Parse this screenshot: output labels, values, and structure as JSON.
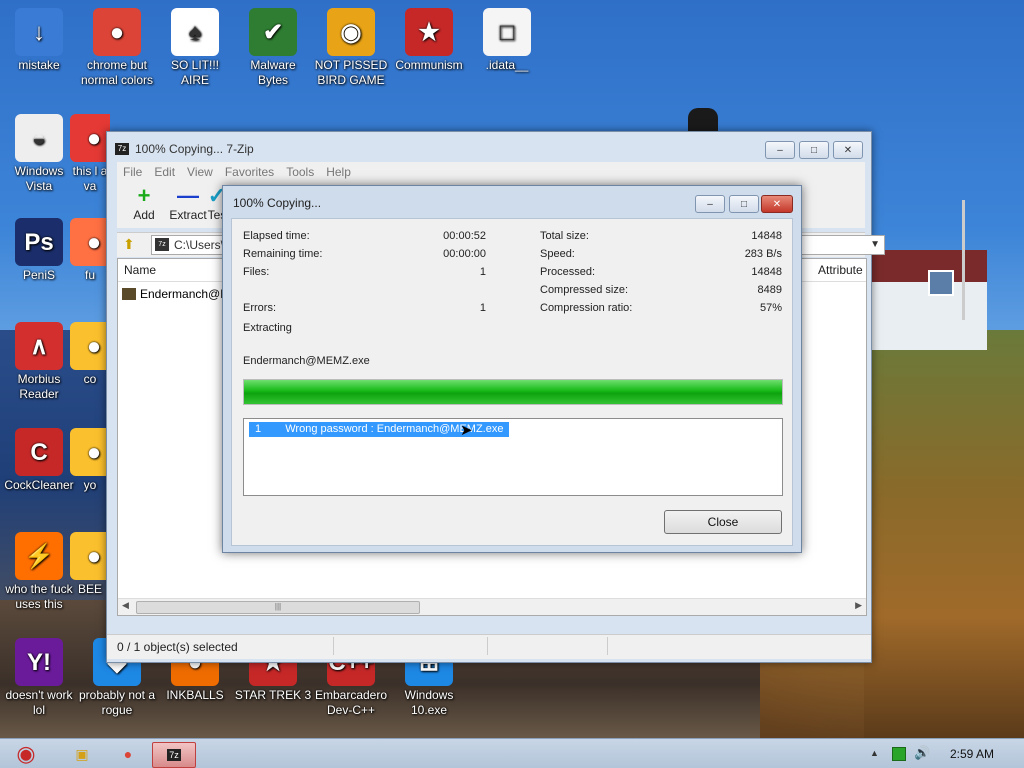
{
  "desktop_icons": [
    {
      "label": "mistake",
      "glyph": "↓",
      "color": "#3a7bd5"
    },
    {
      "label": "chrome but normal colors",
      "glyph": "●",
      "color": "#db4437"
    },
    {
      "label": "SO LIT!!! AIRE",
      "glyph": "♠",
      "color": "#ffffff"
    },
    {
      "label": "Malware Bytes",
      "glyph": "✔",
      "color": "#2e7d32"
    },
    {
      "label": "NOT PISSED BIRD GAME",
      "glyph": "◉",
      "color": "#e8a317"
    },
    {
      "label": "Communism",
      "glyph": "★",
      "color": "#c62828"
    },
    {
      "label": ".idata__",
      "glyph": "□",
      "color": "#f5f5f5"
    },
    {
      "label": "Windows Vista",
      "glyph": "◒",
      "color": "#eeeeee"
    },
    {
      "label": "this l a va",
      "glyph": "●",
      "color": "#e53935"
    },
    {
      "label": "PeniS",
      "glyph": "Ps",
      "color": "#1b2e6b"
    },
    {
      "label": "fu",
      "glyph": "●",
      "color": "#ff7043"
    },
    {
      "label": "Morbius Reader",
      "glyph": "∧",
      "color": "#d32f2f"
    },
    {
      "label": "co",
      "glyph": "●",
      "color": "#fbc02d"
    },
    {
      "label": "CockCleaner",
      "glyph": "C",
      "color": "#c62828"
    },
    {
      "label": "yo",
      "glyph": "●",
      "color": "#fbc02d"
    },
    {
      "label": "who the fuck uses this",
      "glyph": "⚡",
      "color": "#ff6f00"
    },
    {
      "label": "BEE",
      "glyph": "●",
      "color": "#fbc02d"
    },
    {
      "label": "doesn't work lol",
      "glyph": "Y!",
      "color": "#6a1b9a"
    },
    {
      "label": "probably not a rogue",
      "glyph": "◆",
      "color": "#1e88e5"
    },
    {
      "label": "INKBALLS",
      "glyph": "●",
      "color": "#ef6c00"
    },
    {
      "label": "STAR TREK 3",
      "glyph": "★",
      "color": "#c62828"
    },
    {
      "label": "Embarcadero Dev-C++",
      "glyph": "C++",
      "color": "#c62828"
    },
    {
      "label": "Windows 10.exe",
      "glyph": "⊞",
      "color": "#1e88e5"
    }
  ],
  "main_window": {
    "title": "100% Copying... 7-Zip",
    "menu": [
      "File",
      "Edit",
      "View",
      "Favorites",
      "Tools",
      "Help"
    ],
    "toolbar": [
      {
        "label": "Add",
        "glyph": "+",
        "color": "#1aaa1a"
      },
      {
        "label": "Extract",
        "glyph": "—",
        "color": "#1a3fcc"
      },
      {
        "label": "Tes",
        "glyph": "✓",
        "color": "#19a0c8"
      }
    ],
    "address": "C:\\Users\\",
    "columns": {
      "name": "Name",
      "attributes": "Attribute"
    },
    "file_row": "Endermanch@M",
    "status": "0 / 1 object(s) selected"
  },
  "dialog": {
    "title": "100% Copying...",
    "left_stats": [
      {
        "label": "Elapsed time:",
        "value": "00:00:52"
      },
      {
        "label": "Remaining time:",
        "value": "00:00:00"
      },
      {
        "label": "Files:",
        "value": "1"
      },
      {
        "label": "",
        "value": ""
      },
      {
        "label": "Errors:",
        "value": "1"
      }
    ],
    "right_stats": [
      {
        "label": "Total size:",
        "value": "14848"
      },
      {
        "label": "Speed:",
        "value": "283 B/s"
      },
      {
        "label": "Processed:",
        "value": "14848"
      },
      {
        "label": "Compressed size:",
        "value": "8489"
      },
      {
        "label": "Compression ratio:",
        "value": "57%"
      }
    ],
    "operation": "Extracting",
    "current_file": "Endermanch@MEMZ.exe",
    "progress": 1.0,
    "message_index": "1",
    "message_text": "Wrong password : Endermanch@MEMZ.exe",
    "close_label": "Close"
  },
  "taskbar": {
    "clock": "2:59 AM"
  }
}
